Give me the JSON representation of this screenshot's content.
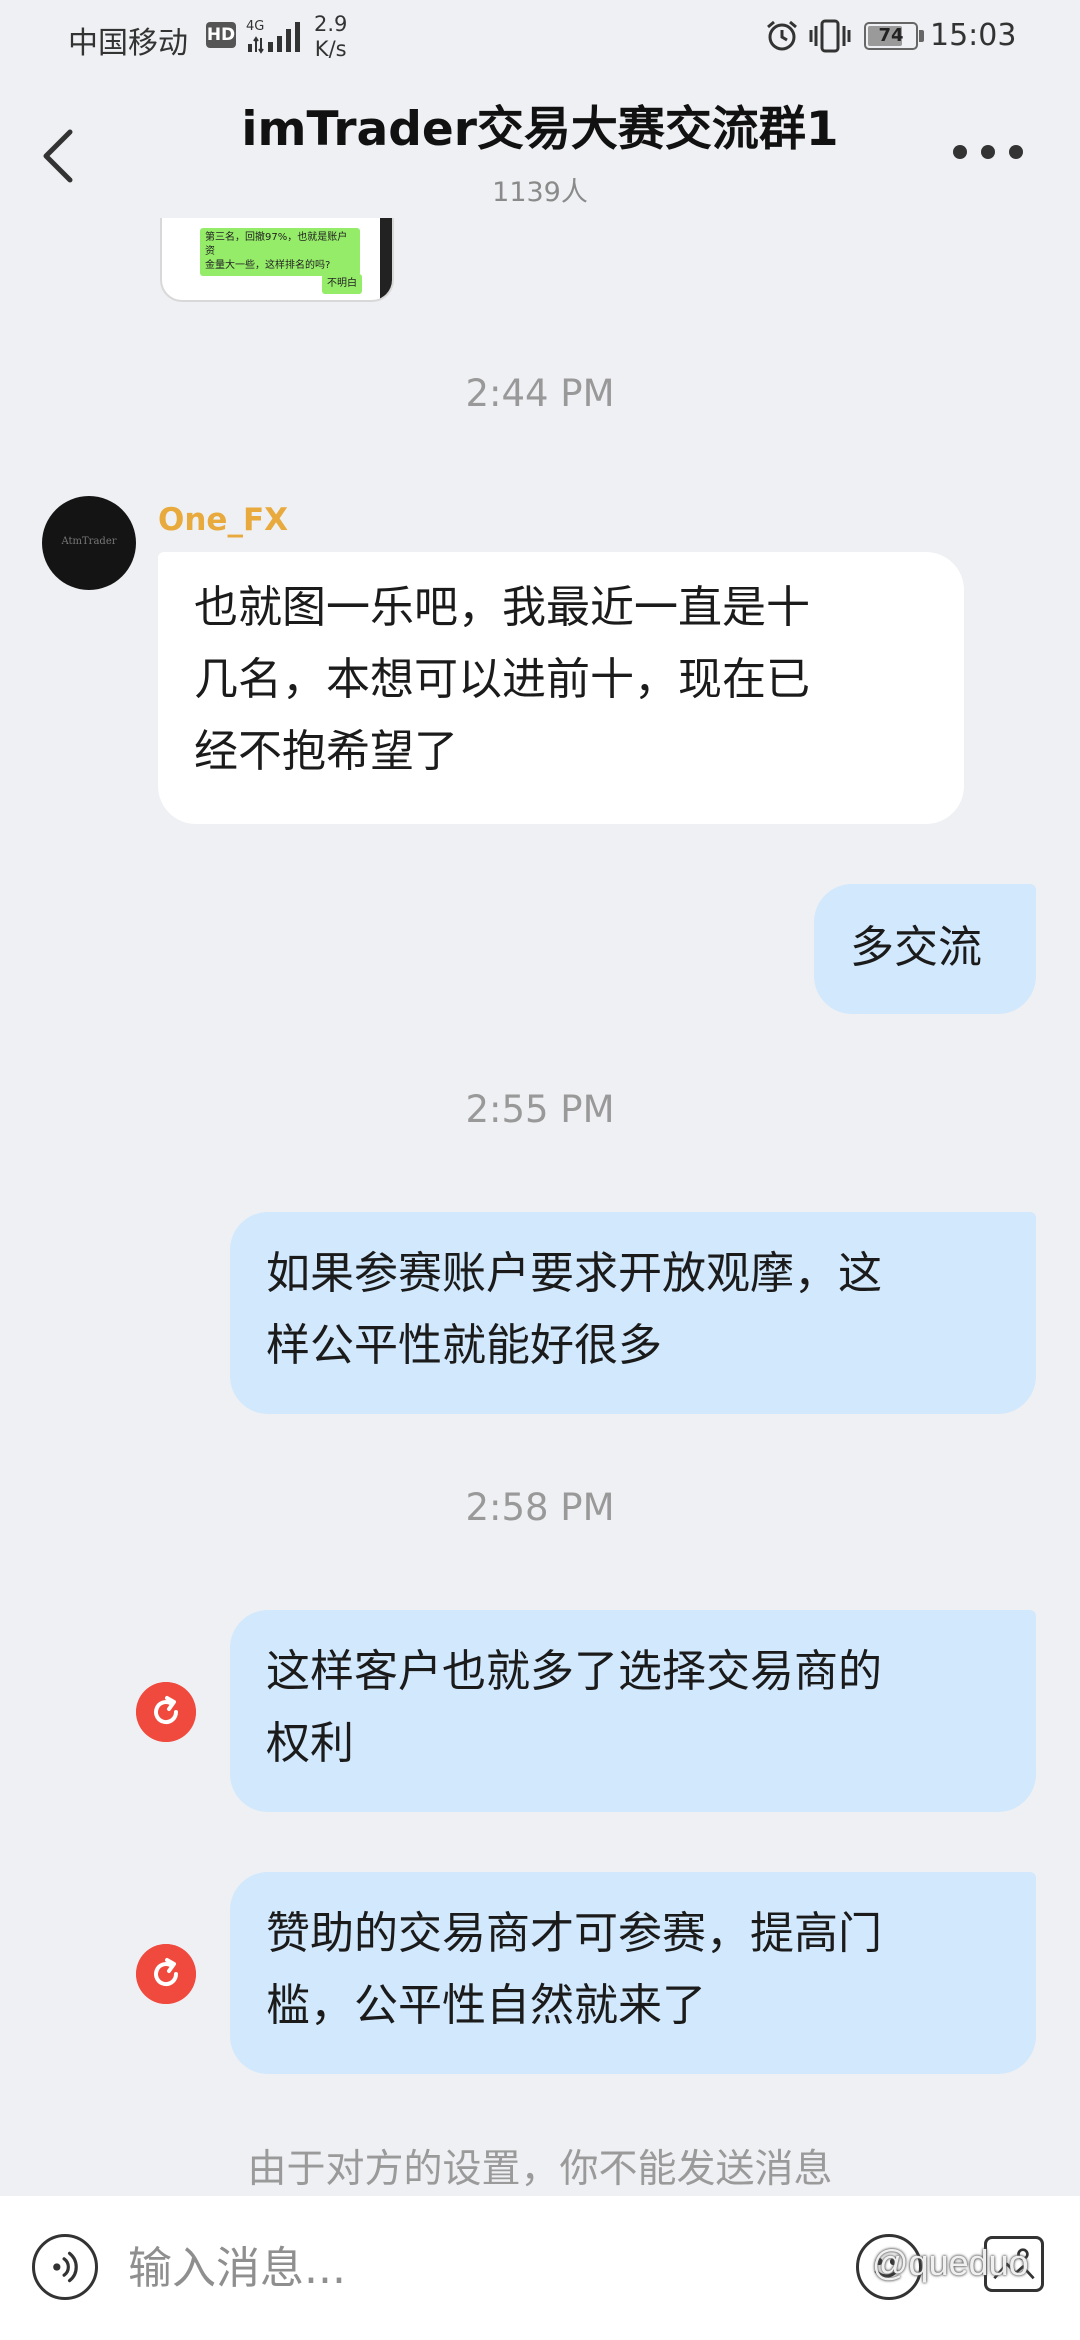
{
  "status_bar": {
    "carrier": "中国移动",
    "hd_badge": "HD",
    "network_type": "4G",
    "speed_value": "2.9",
    "speed_unit": "K/s",
    "battery_level": 74,
    "battery_label": "74",
    "time": "15:03",
    "icons": [
      "signal-icon",
      "alarm-icon",
      "vibrate-icon",
      "battery-icon"
    ]
  },
  "header": {
    "title": "imTrader交易大赛交流群1",
    "member_count": "1139人",
    "back_icon": "chevron-left-icon",
    "more_icon": "more-horizontal-icon"
  },
  "thumbnail": {
    "line1": "第三名，回撤97%，也就是账户资",
    "line2": "金量大一些，这样排名的吗?",
    "reply": "不明白"
  },
  "messages": [
    {
      "type": "timestamp",
      "text": "2:44 PM"
    },
    {
      "type": "incoming",
      "sender": "One_FX",
      "avatar_text": "AtmTrader",
      "lines": [
        "也就图一乐吧，我最近一直是十",
        "几名，本想可以进前十，现在已",
        "经不抱希望了"
      ]
    },
    {
      "type": "outgoing",
      "lines": [
        "多交流"
      ]
    },
    {
      "type": "timestamp",
      "text": "2:55 PM"
    },
    {
      "type": "outgoing",
      "lines": [
        "如果参赛账户要求开放观摩，这",
        "样公平性就能好很多"
      ]
    },
    {
      "type": "timestamp",
      "text": "2:58 PM"
    },
    {
      "type": "outgoing",
      "failed": true,
      "lines": [
        "这样客户也就多了选择交易商的",
        "权利"
      ]
    },
    {
      "type": "outgoing",
      "failed": true,
      "lines": [
        "赞助的交易商才可参赛，提高门",
        "槛，公平性自然就来了"
      ]
    }
  ],
  "notice": "由于对方的设置，你不能发送消息",
  "input_bar": {
    "placeholder": "输入消息...",
    "voice_icon": "voice-icon",
    "emoji_icon": "emoji-icon",
    "image_icon": "image-icon"
  },
  "watermark": "@queduo",
  "colors": {
    "background": "#eff0f3",
    "outgoing_bubble": "#d2e8fc",
    "incoming_bubble": "#ffffff",
    "sender_name": "#e8a93d",
    "resend_icon": "#f04a3e"
  }
}
